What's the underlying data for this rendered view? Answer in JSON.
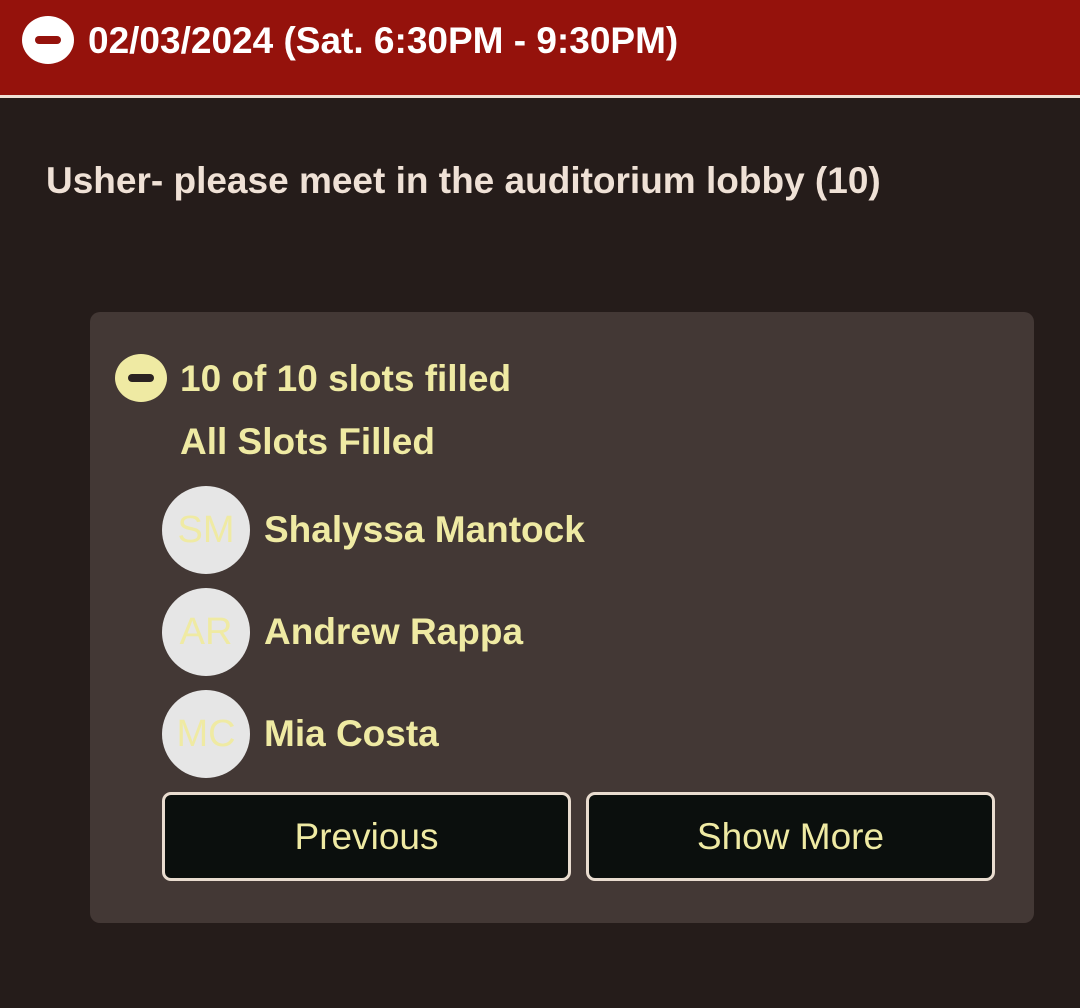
{
  "header": {
    "title": "02/03/2024 (Sat. 6:30PM - 9:30PM)",
    "toggle_icon": "minus-circle-icon",
    "background_color": "#95120c"
  },
  "role": {
    "title": "Usher- please meet in the auditorium lobby (10)"
  },
  "slots": {
    "count_text": "10 of 10 slots filled",
    "status_text": "All Slots Filled",
    "toggle_icon": "minus-circle-icon",
    "accent_color": "#efeaa3"
  },
  "volunteers": [
    {
      "initials": "SM",
      "name": "Shalyssa Mantock"
    },
    {
      "initials": "AR",
      "name": "Andrew Rappa"
    },
    {
      "initials": "MC",
      "name": "Mia Costa"
    }
  ],
  "buttons": {
    "previous_label": "Previous",
    "show_more_label": "Show More"
  }
}
